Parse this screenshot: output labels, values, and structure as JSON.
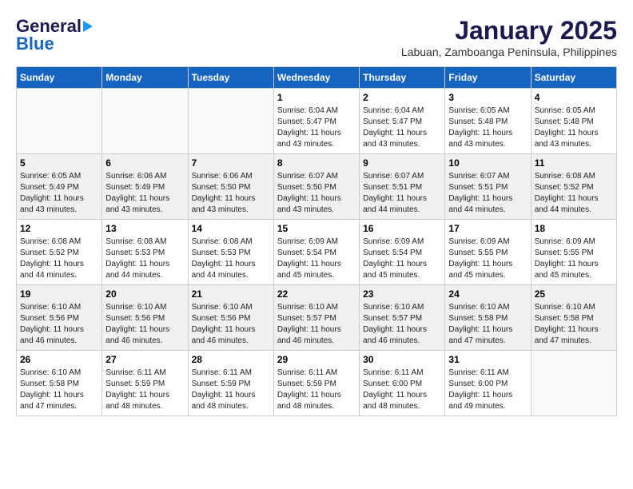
{
  "header": {
    "logo_general": "General",
    "logo_blue": "Blue",
    "title": "January 2025",
    "location": "Labuan, Zamboanga Peninsula, Philippines"
  },
  "days_of_week": [
    "Sunday",
    "Monday",
    "Tuesday",
    "Wednesday",
    "Thursday",
    "Friday",
    "Saturday"
  ],
  "weeks": [
    {
      "shaded": false,
      "days": [
        {
          "num": "",
          "info": "",
          "empty": true
        },
        {
          "num": "",
          "info": "",
          "empty": true
        },
        {
          "num": "",
          "info": "",
          "empty": true
        },
        {
          "num": "1",
          "info": "Sunrise: 6:04 AM\nSunset: 5:47 PM\nDaylight: 11 hours\nand 43 minutes.",
          "empty": false
        },
        {
          "num": "2",
          "info": "Sunrise: 6:04 AM\nSunset: 5:47 PM\nDaylight: 11 hours\nand 43 minutes.",
          "empty": false
        },
        {
          "num": "3",
          "info": "Sunrise: 6:05 AM\nSunset: 5:48 PM\nDaylight: 11 hours\nand 43 minutes.",
          "empty": false
        },
        {
          "num": "4",
          "info": "Sunrise: 6:05 AM\nSunset: 5:48 PM\nDaylight: 11 hours\nand 43 minutes.",
          "empty": false
        }
      ]
    },
    {
      "shaded": true,
      "days": [
        {
          "num": "5",
          "info": "Sunrise: 6:05 AM\nSunset: 5:49 PM\nDaylight: 11 hours\nand 43 minutes.",
          "empty": false
        },
        {
          "num": "6",
          "info": "Sunrise: 6:06 AM\nSunset: 5:49 PM\nDaylight: 11 hours\nand 43 minutes.",
          "empty": false
        },
        {
          "num": "7",
          "info": "Sunrise: 6:06 AM\nSunset: 5:50 PM\nDaylight: 11 hours\nand 43 minutes.",
          "empty": false
        },
        {
          "num": "8",
          "info": "Sunrise: 6:07 AM\nSunset: 5:50 PM\nDaylight: 11 hours\nand 43 minutes.",
          "empty": false
        },
        {
          "num": "9",
          "info": "Sunrise: 6:07 AM\nSunset: 5:51 PM\nDaylight: 11 hours\nand 44 minutes.",
          "empty": false
        },
        {
          "num": "10",
          "info": "Sunrise: 6:07 AM\nSunset: 5:51 PM\nDaylight: 11 hours\nand 44 minutes.",
          "empty": false
        },
        {
          "num": "11",
          "info": "Sunrise: 6:08 AM\nSunset: 5:52 PM\nDaylight: 11 hours\nand 44 minutes.",
          "empty": false
        }
      ]
    },
    {
      "shaded": false,
      "days": [
        {
          "num": "12",
          "info": "Sunrise: 6:08 AM\nSunset: 5:52 PM\nDaylight: 11 hours\nand 44 minutes.",
          "empty": false
        },
        {
          "num": "13",
          "info": "Sunrise: 6:08 AM\nSunset: 5:53 PM\nDaylight: 11 hours\nand 44 minutes.",
          "empty": false
        },
        {
          "num": "14",
          "info": "Sunrise: 6:08 AM\nSunset: 5:53 PM\nDaylight: 11 hours\nand 44 minutes.",
          "empty": false
        },
        {
          "num": "15",
          "info": "Sunrise: 6:09 AM\nSunset: 5:54 PM\nDaylight: 11 hours\nand 45 minutes.",
          "empty": false
        },
        {
          "num": "16",
          "info": "Sunrise: 6:09 AM\nSunset: 5:54 PM\nDaylight: 11 hours\nand 45 minutes.",
          "empty": false
        },
        {
          "num": "17",
          "info": "Sunrise: 6:09 AM\nSunset: 5:55 PM\nDaylight: 11 hours\nand 45 minutes.",
          "empty": false
        },
        {
          "num": "18",
          "info": "Sunrise: 6:09 AM\nSunset: 5:55 PM\nDaylight: 11 hours\nand 45 minutes.",
          "empty": false
        }
      ]
    },
    {
      "shaded": true,
      "days": [
        {
          "num": "19",
          "info": "Sunrise: 6:10 AM\nSunset: 5:56 PM\nDaylight: 11 hours\nand 46 minutes.",
          "empty": false
        },
        {
          "num": "20",
          "info": "Sunrise: 6:10 AM\nSunset: 5:56 PM\nDaylight: 11 hours\nand 46 minutes.",
          "empty": false
        },
        {
          "num": "21",
          "info": "Sunrise: 6:10 AM\nSunset: 5:56 PM\nDaylight: 11 hours\nand 46 minutes.",
          "empty": false
        },
        {
          "num": "22",
          "info": "Sunrise: 6:10 AM\nSunset: 5:57 PM\nDaylight: 11 hours\nand 46 minutes.",
          "empty": false
        },
        {
          "num": "23",
          "info": "Sunrise: 6:10 AM\nSunset: 5:57 PM\nDaylight: 11 hours\nand 46 minutes.",
          "empty": false
        },
        {
          "num": "24",
          "info": "Sunrise: 6:10 AM\nSunset: 5:58 PM\nDaylight: 11 hours\nand 47 minutes.",
          "empty": false
        },
        {
          "num": "25",
          "info": "Sunrise: 6:10 AM\nSunset: 5:58 PM\nDaylight: 11 hours\nand 47 minutes.",
          "empty": false
        }
      ]
    },
    {
      "shaded": false,
      "days": [
        {
          "num": "26",
          "info": "Sunrise: 6:10 AM\nSunset: 5:58 PM\nDaylight: 11 hours\nand 47 minutes.",
          "empty": false
        },
        {
          "num": "27",
          "info": "Sunrise: 6:11 AM\nSunset: 5:59 PM\nDaylight: 11 hours\nand 48 minutes.",
          "empty": false
        },
        {
          "num": "28",
          "info": "Sunrise: 6:11 AM\nSunset: 5:59 PM\nDaylight: 11 hours\nand 48 minutes.",
          "empty": false
        },
        {
          "num": "29",
          "info": "Sunrise: 6:11 AM\nSunset: 5:59 PM\nDaylight: 11 hours\nand 48 minutes.",
          "empty": false
        },
        {
          "num": "30",
          "info": "Sunrise: 6:11 AM\nSunset: 6:00 PM\nDaylight: 11 hours\nand 48 minutes.",
          "empty": false
        },
        {
          "num": "31",
          "info": "Sunrise: 6:11 AM\nSunset: 6:00 PM\nDaylight: 11 hours\nand 49 minutes.",
          "empty": false
        },
        {
          "num": "",
          "info": "",
          "empty": true
        }
      ]
    }
  ]
}
